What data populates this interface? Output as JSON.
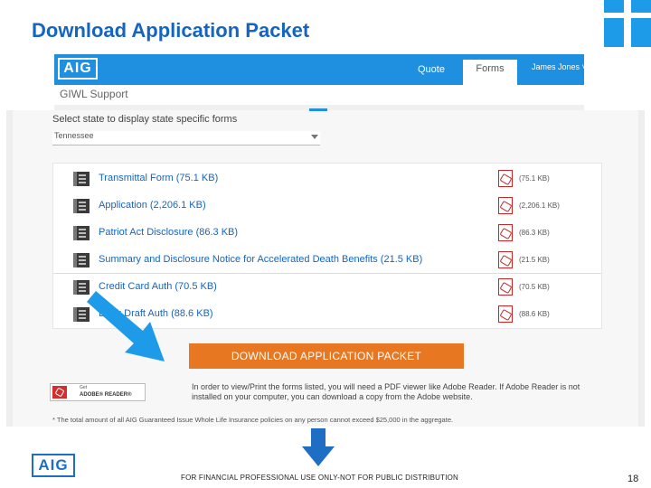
{
  "slide": {
    "title": "Download Application Packet",
    "footer_logo": "AIG",
    "disclaimer": "FOR FINANCIAL PROFESSIONAL USE ONLY-NOT FOR PUBLIC DISTRIBUTION",
    "page_number": "18"
  },
  "app": {
    "logo": "AIG",
    "nav": {
      "quote": "Quote",
      "forms": "Forms",
      "user": "James Jones ˅"
    },
    "subheader": "GIWL Support",
    "state_label": "Select state to display state specific forms",
    "state_value": "Tennessee"
  },
  "forms": [
    {
      "name": "Transmittal Form (75.1 KB)",
      "size": "(75.1 KB)"
    },
    {
      "name": "Application (2,206.1 KB)",
      "size": "(2,206.1 KB)"
    },
    {
      "name": "Patriot Act Disclosure (86.3 KB)",
      "size": "(86.3 KB)"
    },
    {
      "name": "Summary and Disclosure Notice for Accelerated Death Benefits (21.5 KB)",
      "size": "(21.5 KB)"
    },
    {
      "name": "Credit Card Auth (70.5 KB)",
      "size": "(70.5 KB)"
    },
    {
      "name": "Bank Draft Auth (88.6 KB)",
      "size": "(88.6 KB)"
    }
  ],
  "download_button": "DOWNLOAD APPLICATION PACKET",
  "adobe": {
    "get": "Get",
    "name": "ADOBE® READER®"
  },
  "reader_note": "In order to view/Print the forms listed, you will need a PDF viewer like Adobe Reader. If Adobe Reader is not installed on your computer, you can download a copy from the Adobe website.",
  "footnote": "* The total amount of all AIG Guaranteed Issue Whole Life Insurance policies on any person cannot exceed $25,000 in the aggregate.",
  "colors": {
    "brand_blue": "#1f8fe0",
    "title_blue": "#1565c0",
    "button_orange": "#e87722",
    "pdf_red": "#c62828"
  }
}
